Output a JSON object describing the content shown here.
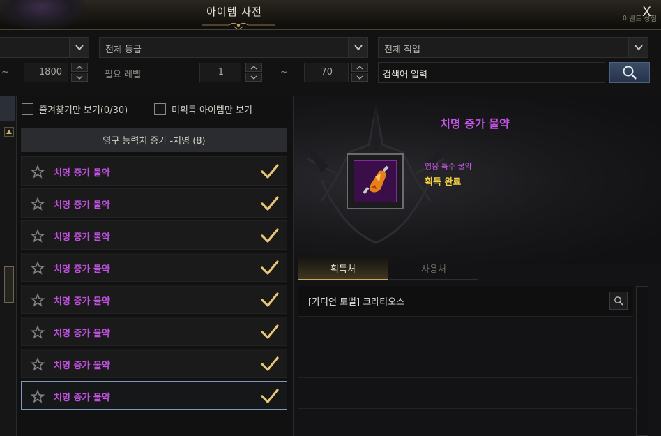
{
  "window": {
    "title": "아이템 사전",
    "close_label": "X",
    "side_tab": "이벤트 상점"
  },
  "filters": {
    "grade_dropdown": "전체 등급",
    "class_dropdown": "전체 직업",
    "level_max_value": "1800",
    "required_level_label": "필요 레벨",
    "req_level_min": "1",
    "req_level_max": "70",
    "tilde": "~",
    "search_placeholder": "검색어 입력"
  },
  "list": {
    "favorites_label": "즐겨찾기만 보기(0/30)",
    "unacquired_label": "미획득 아이템만 보기",
    "group_header": "영구 능력치 증가 -치명 (8)",
    "items": [
      {
        "name": "치명 증가 물약",
        "acquired": true
      },
      {
        "name": "치명 증가 물약",
        "acquired": true
      },
      {
        "name": "치명 증가 물약",
        "acquired": true
      },
      {
        "name": "치명 증가 물약",
        "acquired": true
      },
      {
        "name": "치명 증가 물약",
        "acquired": true
      },
      {
        "name": "치명 증가 물약",
        "acquired": true
      },
      {
        "name": "치명 증가 물약",
        "acquired": true
      },
      {
        "name": "치명 증가 물약",
        "acquired": true
      }
    ],
    "selected_index": 7
  },
  "detail": {
    "title": "치명 증가 물약",
    "item_type": "영웅 특수 물약",
    "status": "획득 완료",
    "tabs": [
      "획득처",
      "사용처"
    ],
    "active_tab": 0,
    "sources": [
      "[가디언 토벌] 크라티오스"
    ]
  },
  "colors": {
    "item_name": "#c150e0",
    "status": "#f0cf44",
    "check": "#e8c874"
  },
  "icons": [
    "chevron-down-icon",
    "chevron-up-icon",
    "search-icon",
    "star-icon",
    "checkmark-icon",
    "close-icon",
    "potion-icon"
  ]
}
